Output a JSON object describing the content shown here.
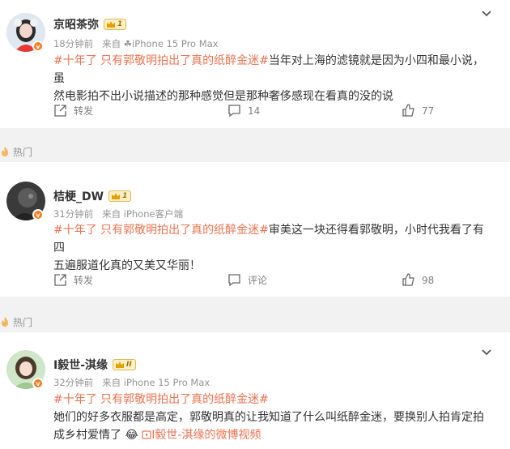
{
  "hot_label": "热门",
  "icon_level_2_label": "II",
  "comments": [
    {
      "name": "京昭茶弥",
      "level": "1",
      "time": "18分钟前",
      "source": "来自 ☘iPhone 15 Pro Max",
      "tag": "#十年了 只有郭敬明拍出了真的纸醉金迷#",
      "text_line1_rest": "当年对上海的滤镜就是因为小四和最小说，虽",
      "text_line2": "然电影拍不出小说描述的那种感觉但是那种奢侈感现在看真的没的说",
      "repost_label": "转发",
      "comment_count": "14",
      "like_count": "77"
    },
    {
      "name": "桔梗_DW",
      "level": "1",
      "time": "31分钟前",
      "source": "来自 iPhone客户端",
      "tag": "#十年了 只有郭敬明拍出了真的纸醉金迷#",
      "text_line1_rest": "审美这一块还得看郭敬明，小时代我看了有四",
      "text_line2": "五遍服道化真的又美又华丽！",
      "repost_label": "转发",
      "comment_label": "评论",
      "like_count": "98"
    },
    {
      "name": "I毅世-淇缘",
      "level": "II",
      "time": "32分钟前",
      "source": "来自 iPhone 15 Pro Max",
      "tag": "#十年了 只有郭敬明拍出了真的纸醉金迷#",
      "text_line2": "她们的好多衣服都是高定，郭敬明真的让我知道了什么叫纸醉金迷，要换别人拍肯定拍",
      "text_line3": "成乡村爱情了",
      "emoji": "😂",
      "video_link": "I毅世-淇缘的微博视频"
    }
  ],
  "colors": {
    "topic": "#eb7350",
    "meta": "#939393",
    "background": "#f2f2f2",
    "verified_badge": "#f77d1d"
  }
}
